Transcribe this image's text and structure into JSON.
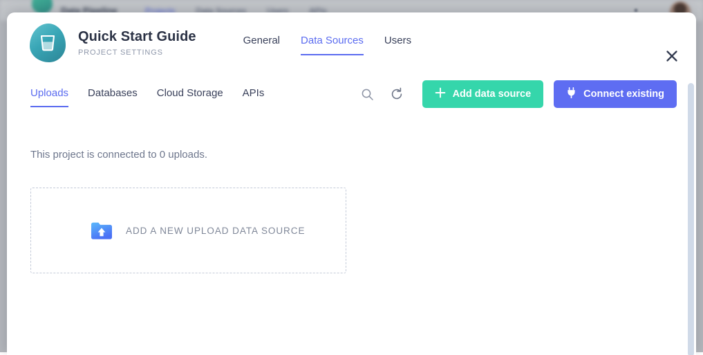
{
  "backdrop": {
    "brand": "Data Pipeline",
    "nav_links": [
      "Projects",
      "Data Sources",
      "Users",
      "APIs"
    ],
    "avatar": "user-avatar"
  },
  "modal": {
    "logo_icon": "glass-cup-icon",
    "title": "Quick Start Guide",
    "subtitle": "PROJECT SETTINGS",
    "close_icon": "close-icon",
    "tabs": [
      {
        "label": "General",
        "active": false
      },
      {
        "label": "Data Sources",
        "active": true
      },
      {
        "label": "Users",
        "active": false
      }
    ]
  },
  "toolbar": {
    "sub_tabs": [
      {
        "label": "Uploads",
        "active": true
      },
      {
        "label": "Databases",
        "active": false
      },
      {
        "label": "Cloud Storage",
        "active": false
      },
      {
        "label": "APIs",
        "active": false
      }
    ],
    "search_icon": "search-icon",
    "refresh_icon": "refresh-icon",
    "add_label": "Add data source",
    "add_icon": "plus-icon",
    "connect_label": "Connect existing",
    "connect_icon": "plug-icon"
  },
  "body": {
    "connection_status": "This project is connected to 0 uploads.",
    "dropzone_label": "ADD A NEW UPLOAD DATA SOURCE",
    "dropzone_icon": "folder-upload-icon"
  },
  "colors": {
    "accent_blue": "#5a6bf0",
    "button_green": "#35d6ab",
    "button_blue": "#5e6df2",
    "title_dark": "#2b3245",
    "muted_text": "#6d768c",
    "logo_teal": "#39a6b6",
    "backdrop_gray": "#b4b7bc"
  }
}
